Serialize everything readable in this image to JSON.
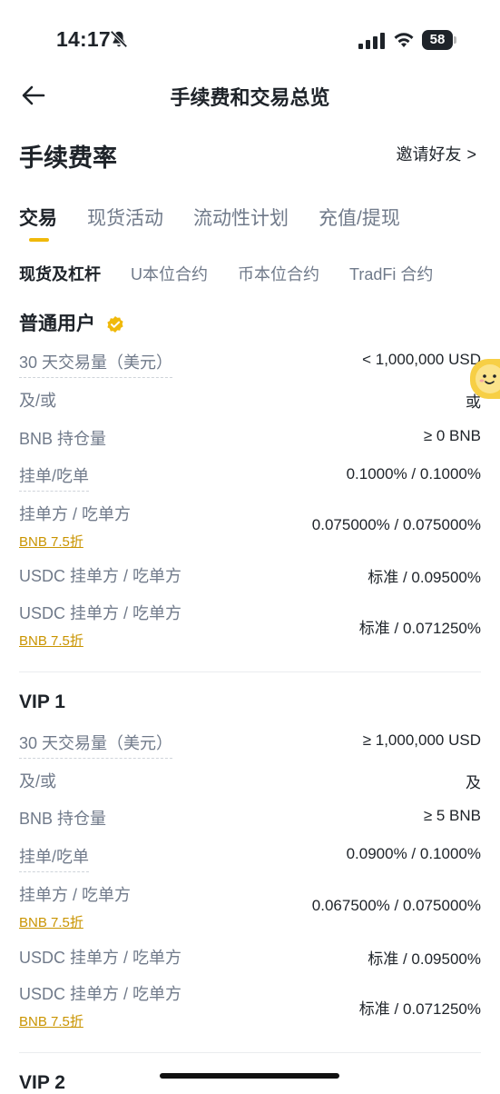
{
  "status": {
    "time": "14:17",
    "battery": "58"
  },
  "nav": {
    "title": "手续费和交易总览"
  },
  "page": {
    "title": "手续费率",
    "invite": "邀请好友",
    "invite_chevron": ">"
  },
  "tabs": [
    "交易",
    "现货活动",
    "流动性计划",
    "充值/提现"
  ],
  "subtabs": [
    "现货及杠杆",
    "U本位合约",
    "币本位合约",
    "TradFi 合约"
  ],
  "tiers": [
    {
      "name": "普通用户",
      "rows": [
        {
          "label": "30 天交易量（美元）",
          "value": "< 1,000,000 USD"
        },
        {
          "label": "及/或",
          "value": "或"
        },
        {
          "label": "BNB 持仓量",
          "value": "≥ 0 BNB"
        },
        {
          "label": "挂单/吃单",
          "value": "0.1000% / 0.1000%"
        },
        {
          "label": "挂单方 / 吃单方",
          "sub": "BNB 7.5折",
          "value": "0.075000% / 0.075000%"
        },
        {
          "label": "USDC 挂单方 / 吃单方",
          "value": "标准 /  0.09500%"
        },
        {
          "label": "USDC 挂单方 / 吃单方",
          "sub": "BNB 7.5折",
          "value": "标准 /  0.071250%"
        }
      ]
    },
    {
      "name": "VIP 1",
      "rows": [
        {
          "label": "30 天交易量（美元）",
          "value": "≥ 1,000,000 USD"
        },
        {
          "label": "及/或",
          "value": "及"
        },
        {
          "label": "BNB 持仓量",
          "value": "≥ 5 BNB"
        },
        {
          "label": "挂单/吃单",
          "value": "0.0900% / 0.1000%"
        },
        {
          "label": "挂单方 / 吃单方",
          "sub": "BNB 7.5折",
          "value": "0.067500% / 0.075000%"
        },
        {
          "label": "USDC 挂单方 / 吃单方",
          "value": "标准 /  0.09500%"
        },
        {
          "label": "USDC 挂单方 / 吃单方",
          "sub": "BNB 7.5折",
          "value": "标准 /  0.071250%"
        }
      ]
    },
    {
      "name": "VIP 2"
    }
  ],
  "colors": {
    "accent": "#f0b90b",
    "link": "#c99400",
    "muted": "#707a8a",
    "text": "#1e2329"
  }
}
